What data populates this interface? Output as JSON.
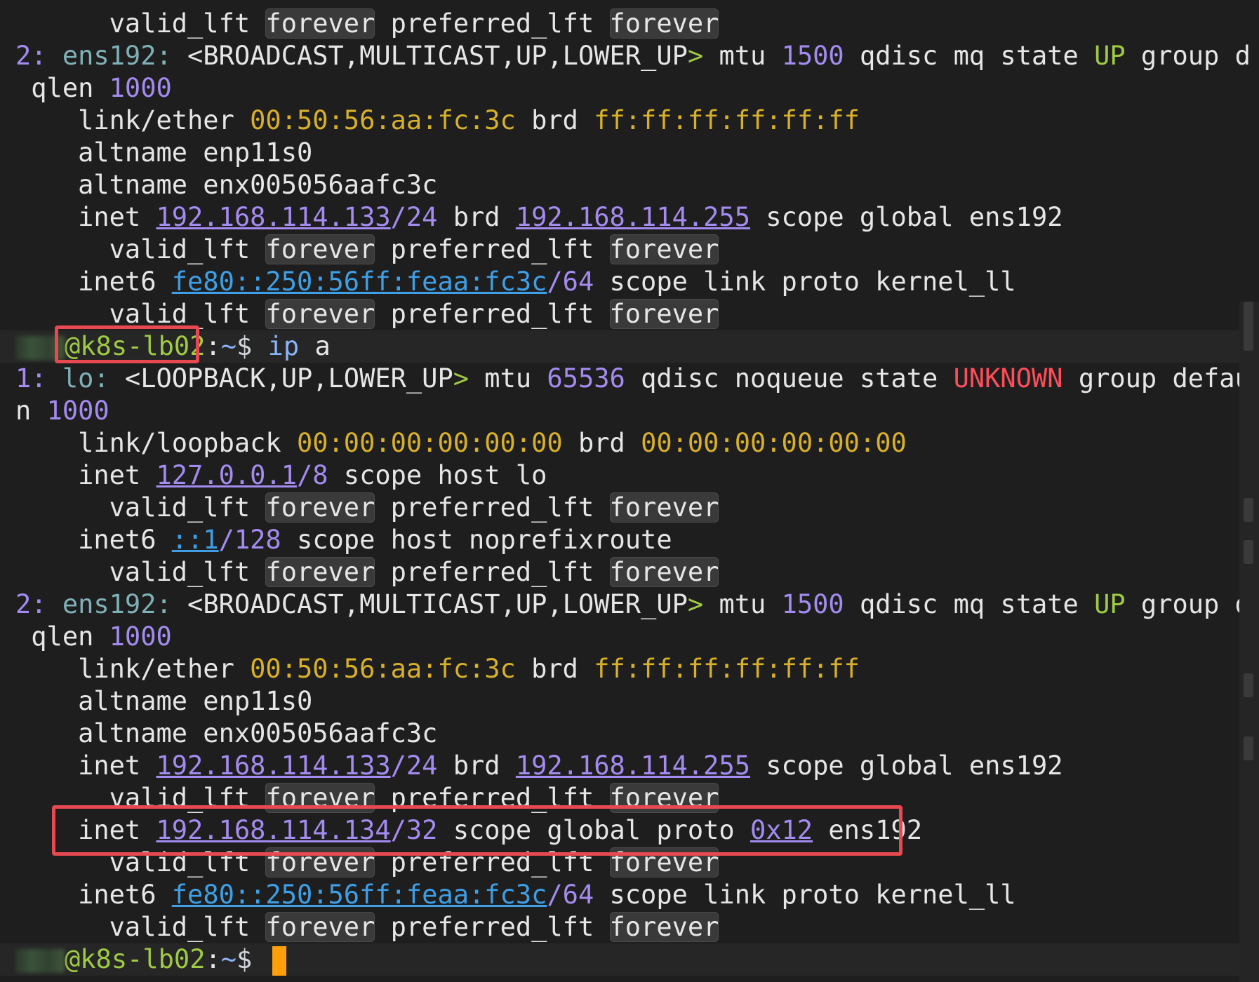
{
  "terminal": {
    "lines": [
      [
        {
          "t": "      valid_lft ",
          "c": "default"
        },
        {
          "t": "forever",
          "c": "chip"
        },
        {
          "t": " preferred_lft ",
          "c": "default"
        },
        {
          "t": "forever",
          "c": "chip"
        }
      ],
      [
        {
          "t": "2: ",
          "c": "num"
        },
        {
          "t": "ens192:",
          "c": "iface"
        },
        {
          "t": " <",
          "c": "default"
        },
        {
          "t": "BROADCAST,MULTICAST,UP,LOWER_UP",
          "c": "default"
        },
        {
          "t": ">",
          "c": "green"
        },
        {
          "t": " mtu ",
          "c": "default"
        },
        {
          "t": "1500",
          "c": "num"
        },
        {
          "t": " qdisc mq state ",
          "c": "default"
        },
        {
          "t": "UP",
          "c": "green"
        },
        {
          "t": " group default",
          "c": "default"
        },
        {
          "t": "↩",
          "c": "wrap"
        }
      ],
      [
        {
          "t": " qlen ",
          "c": "default"
        },
        {
          "t": "1000",
          "c": "num"
        }
      ],
      [
        {
          "t": "    link/ether ",
          "c": "default"
        },
        {
          "t": "00:50:56:aa:fc:3c",
          "c": "mac"
        },
        {
          "t": " brd ",
          "c": "default"
        },
        {
          "t": "ff:ff:ff:ff:ff:ff",
          "c": "mac"
        }
      ],
      [
        {
          "t": "    altname enp11s0",
          "c": "default"
        }
      ],
      [
        {
          "t": "    altname enx005056aafc3c",
          "c": "default"
        }
      ],
      [
        {
          "t": "    inet ",
          "c": "default"
        },
        {
          "t": "192.168.114.133",
          "c": "ip"
        },
        {
          "t": "/24",
          "c": "num"
        },
        {
          "t": " brd ",
          "c": "default"
        },
        {
          "t": "192.168.114.255",
          "c": "ip"
        },
        {
          "t": " scope global ens192",
          "c": "default"
        }
      ],
      [
        {
          "t": "      valid_lft ",
          "c": "default"
        },
        {
          "t": "forever",
          "c": "chip"
        },
        {
          "t": " preferred_lft ",
          "c": "default"
        },
        {
          "t": "forever",
          "c": "chip"
        }
      ],
      [
        {
          "t": "    inet6 ",
          "c": "default"
        },
        {
          "t": "fe80::250:56ff:feaa:fc3c",
          "c": "ipb"
        },
        {
          "t": "/64",
          "c": "num"
        },
        {
          "t": " scope link proto kernel_ll",
          "c": "default"
        }
      ],
      [
        {
          "t": "      valid_lft ",
          "c": "default"
        },
        {
          "t": "forever",
          "c": "chip"
        },
        {
          "t": " preferred_lft ",
          "c": "default"
        },
        {
          "t": "forever",
          "c": "chip"
        }
      ],
      [
        {
          "t": "",
          "c": "blur"
        },
        {
          "t": "@k8s-lb02",
          "c": "host"
        },
        {
          "t": ":",
          "c": "default"
        },
        {
          "t": "~",
          "c": "path"
        },
        {
          "t": "$ ",
          "c": "dollar"
        },
        {
          "t": "ip",
          "c": "cmd"
        },
        {
          "t": " a",
          "c": "default"
        }
      ],
      [
        {
          "t": "1: ",
          "c": "num"
        },
        {
          "t": "lo:",
          "c": "iface"
        },
        {
          "t": " <",
          "c": "default"
        },
        {
          "t": "LOOPBACK,UP,LOWER_UP",
          "c": "default"
        },
        {
          "t": ">",
          "c": "green"
        },
        {
          "t": " mtu ",
          "c": "default"
        },
        {
          "t": "65536",
          "c": "num"
        },
        {
          "t": " qdisc noqueue state ",
          "c": "default"
        },
        {
          "t": "UNKNOWN",
          "c": "red"
        },
        {
          "t": " group default qle",
          "c": "default"
        },
        {
          "t": "↩",
          "c": "wrap"
        }
      ],
      [
        {
          "t": "n ",
          "c": "default"
        },
        {
          "t": "1000",
          "c": "num"
        }
      ],
      [
        {
          "t": "    link/loopback ",
          "c": "default"
        },
        {
          "t": "00:00:00:00:00:00",
          "c": "mac"
        },
        {
          "t": " brd ",
          "c": "default"
        },
        {
          "t": "00:00:00:00:00:00",
          "c": "mac"
        }
      ],
      [
        {
          "t": "    inet ",
          "c": "default"
        },
        {
          "t": "127.0.0.1",
          "c": "ip"
        },
        {
          "t": "/8",
          "c": "num"
        },
        {
          "t": " scope host lo",
          "c": "default"
        }
      ],
      [
        {
          "t": "      valid_lft ",
          "c": "default"
        },
        {
          "t": "forever",
          "c": "chip"
        },
        {
          "t": " preferred_lft ",
          "c": "default"
        },
        {
          "t": "forever",
          "c": "chip"
        }
      ],
      [
        {
          "t": "    inet6 ",
          "c": "default"
        },
        {
          "t": "::1",
          "c": "ipb"
        },
        {
          "t": "/128",
          "c": "num"
        },
        {
          "t": " scope host noprefixroute",
          "c": "default"
        }
      ],
      [
        {
          "t": "      valid_lft ",
          "c": "default"
        },
        {
          "t": "forever",
          "c": "chip"
        },
        {
          "t": " preferred_lft ",
          "c": "default"
        },
        {
          "t": "forever",
          "c": "chip"
        }
      ],
      [
        {
          "t": "2: ",
          "c": "num"
        },
        {
          "t": "ens192:",
          "c": "iface"
        },
        {
          "t": " <",
          "c": "default"
        },
        {
          "t": "BROADCAST,MULTICAST,UP,LOWER_UP",
          "c": "default"
        },
        {
          "t": ">",
          "c": "green"
        },
        {
          "t": " mtu ",
          "c": "default"
        },
        {
          "t": "1500",
          "c": "num"
        },
        {
          "t": " qdisc mq state ",
          "c": "default"
        },
        {
          "t": "UP",
          "c": "green"
        },
        {
          "t": " group default",
          "c": "default"
        },
        {
          "t": "↩",
          "c": "wrap"
        }
      ],
      [
        {
          "t": " qlen ",
          "c": "default"
        },
        {
          "t": "1000",
          "c": "num"
        }
      ],
      [
        {
          "t": "    link/ether ",
          "c": "default"
        },
        {
          "t": "00:50:56:aa:fc:3c",
          "c": "mac"
        },
        {
          "t": " brd ",
          "c": "default"
        },
        {
          "t": "ff:ff:ff:ff:ff:ff",
          "c": "mac"
        }
      ],
      [
        {
          "t": "    altname enp11s0",
          "c": "default"
        }
      ],
      [
        {
          "t": "    altname enx005056aafc3c",
          "c": "default"
        }
      ],
      [
        {
          "t": "    inet ",
          "c": "default"
        },
        {
          "t": "192.168.114.133",
          "c": "ip"
        },
        {
          "t": "/24",
          "c": "num"
        },
        {
          "t": " brd ",
          "c": "default"
        },
        {
          "t": "192.168.114.255",
          "c": "ip"
        },
        {
          "t": " scope global ens192",
          "c": "default"
        }
      ],
      [
        {
          "t": "      valid_lft ",
          "c": "default"
        },
        {
          "t": "forever",
          "c": "chip"
        },
        {
          "t": " preferred_lft ",
          "c": "default"
        },
        {
          "t": "forever",
          "c": "chip"
        }
      ],
      [
        {
          "t": "    inet ",
          "c": "default"
        },
        {
          "t": "192.168.114.134",
          "c": "ip"
        },
        {
          "t": "/32",
          "c": "num"
        },
        {
          "t": " scope global proto ",
          "c": "default"
        },
        {
          "t": "0x12",
          "c": "ip"
        },
        {
          "t": " ens192",
          "c": "default"
        }
      ],
      [
        {
          "t": "      valid_lft ",
          "c": "default"
        },
        {
          "t": "forever",
          "c": "chip"
        },
        {
          "t": " preferred_lft ",
          "c": "default"
        },
        {
          "t": "forever",
          "c": "chip"
        }
      ],
      [
        {
          "t": "    inet6 ",
          "c": "default"
        },
        {
          "t": "fe80::250:56ff:feaa:fc3c",
          "c": "ipb"
        },
        {
          "t": "/64",
          "c": "num"
        },
        {
          "t": " scope link proto kernel_ll",
          "c": "default"
        }
      ],
      [
        {
          "t": "      valid_lft ",
          "c": "default"
        },
        {
          "t": "forever",
          "c": "chip"
        },
        {
          "t": " preferred_lft ",
          "c": "default"
        },
        {
          "t": "forever",
          "c": "chip"
        }
      ],
      [
        {
          "t": "",
          "c": "blur"
        },
        {
          "t": "@k8s-lb02",
          "c": "host"
        },
        {
          "t": ":",
          "c": "default"
        },
        {
          "t": "~",
          "c": "path"
        },
        {
          "t": "$ ",
          "c": "dollar"
        },
        {
          "t": "",
          "c": "cursor"
        }
      ]
    ]
  },
  "colors": {
    "background": "#1e1e1e",
    "annotation": "#e8484f",
    "cursor": "#ff9f0a"
  }
}
